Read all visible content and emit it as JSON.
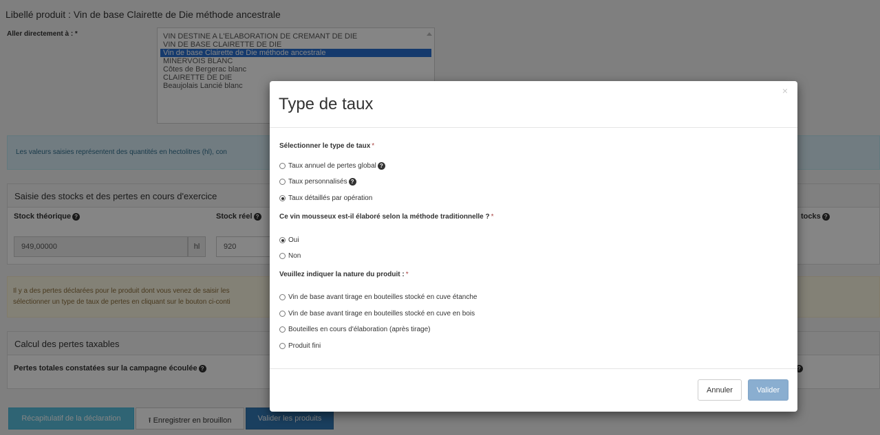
{
  "page": {
    "product_title": "Libellé produit : Vin de base Clairette de Die méthode ancestrale",
    "goto_label": "Aller directement à : *",
    "goto_options": [
      "VIN DESTINE A L'ELABORATION DE CREMANT DE DIE",
      "VIN DE BASE CLAIRETTE DE DIE",
      "Vin de base Clairette de Die méthode ancestrale",
      "MINERVOIS BLANC",
      "Côtes de Bergerac blanc",
      "CLAIRETTE DE DIE",
      "Beaujolais Lancié blanc"
    ],
    "goto_selected_index": 2,
    "info_alert": "Les valeurs saisies représentent des quantités en hectolitres (hl), con",
    "stocks_panel": {
      "heading": "Saisie des stocks et des pertes en cours d'exercice",
      "stock_theorique_label": "Stock théorique",
      "stock_theorique_value": "949,00000",
      "stock_theorique_unit": "hl",
      "stock_reel_label": "Stock réel",
      "stock_reel_value": "920",
      "right_label": "tocks"
    },
    "warning_alert": {
      "line1": "Il y a des pertes déclarées pour le produit dont vous venez de saisir les",
      "line2": "sélectionner un type de taux de pertes en cliquant sur le bouton ci-conti"
    },
    "losses_panel": {
      "heading": "Calcul des pertes taxables",
      "total_label": "Pertes totales constatées sur la campagne écoulée"
    },
    "bottom_buttons": {
      "recap": "Récapitulatif de la déclaration",
      "draft": "Enregistrer en brouillon",
      "draft_icon": "upload-icon",
      "validate_products": "Valider les produits"
    }
  },
  "modal": {
    "close_glyph": "×",
    "title": "Type de taux",
    "q1_label": "Sélectionner le type de taux",
    "q1_options": [
      {
        "label": "Taux annuel de pertes global",
        "help": true,
        "checked": false
      },
      {
        "label": "Taux personnalisés",
        "help": true,
        "checked": false
      },
      {
        "label": "Taux détaillés par opération",
        "help": false,
        "checked": true
      }
    ],
    "q2_label": "Ce vin mousseux est-il élaboré selon la méthode traditionnelle ?",
    "q2_options": [
      {
        "label": "Oui",
        "checked": true
      },
      {
        "label": "Non",
        "checked": false
      }
    ],
    "q3_label": "Veuillez indiquer la nature du produit :",
    "q3_options": [
      {
        "label": "Vin de base avant tirage en bouteilles stocké en cuve étanche",
        "checked": false
      },
      {
        "label": "Vin de base avant tirage en bouteilles stocké en cuve en bois",
        "checked": false
      },
      {
        "label": "Bouteilles en cours d'élaboration (après tirage)",
        "checked": false
      },
      {
        "label": "Produit fini",
        "checked": false
      }
    ],
    "required_mark": "*",
    "cancel_label": "Annuler",
    "ok_label": "Valider"
  },
  "colors": {
    "selected_option": "#2a6fd1",
    "info_btn": "#5bc0de",
    "primary_btn": "#337ab7",
    "ok_btn_disabled": "#8aaed0"
  }
}
